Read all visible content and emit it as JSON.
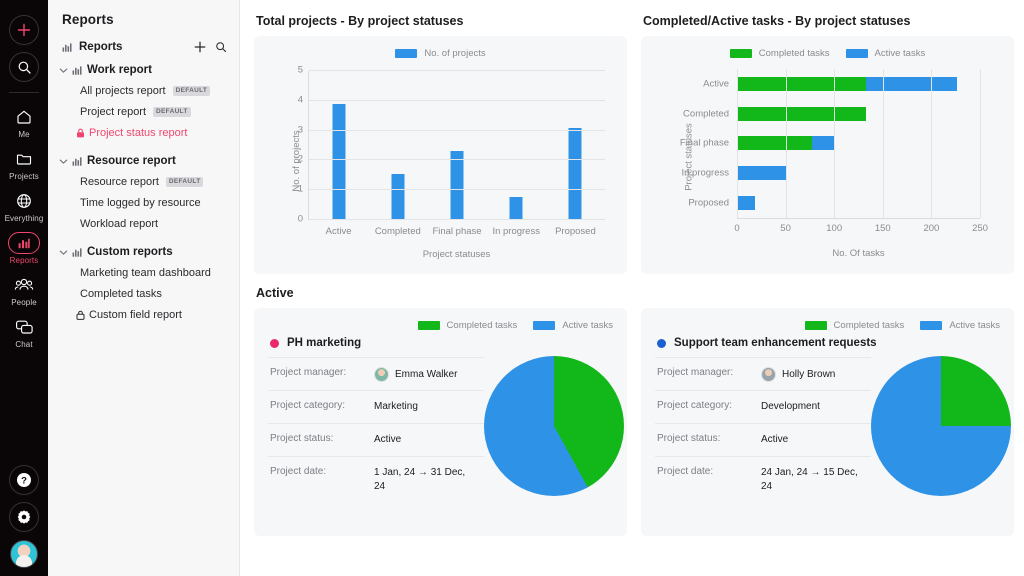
{
  "colors": {
    "green": "#12b81a",
    "blue": "#2e93e6",
    "accent_pink": "#f0466e",
    "pink_dot": "#e8286b",
    "blue_dot": "#1c5fd0",
    "rail_bg": "#0a0608",
    "panel_bg": "#f7f7f8",
    "card_bg": "#f6f7f9"
  },
  "rail": {
    "add_icon": "plus-icon",
    "search_icon": "search-icon",
    "items": [
      {
        "label": "Me",
        "icon": "home-icon",
        "active": false
      },
      {
        "label": "Projects",
        "icon": "folder-icon",
        "active": false
      },
      {
        "label": "Everything",
        "icon": "globe-icon",
        "active": false
      },
      {
        "label": "Reports",
        "icon": "bar-chart-icon",
        "active": true
      },
      {
        "label": "People",
        "icon": "people-icon",
        "active": false
      },
      {
        "label": "Chat",
        "icon": "chat-icon",
        "active": false
      }
    ],
    "bottom": [
      {
        "icon": "help-icon"
      },
      {
        "icon": "settings-gear-icon"
      },
      {
        "icon": "user-avatar"
      }
    ]
  },
  "panel": {
    "title": "Reports",
    "root": {
      "label": "Reports",
      "icon": "bar-chart-icon"
    },
    "actions": {
      "add": "plus-icon",
      "search": "search-icon"
    },
    "badge_default": "DEFAULT",
    "groups": [
      {
        "label": "Work report",
        "expanded": true,
        "items": [
          {
            "label": "All projects report",
            "badge": "DEFAULT",
            "locked": false,
            "selected": false
          },
          {
            "label": "Project report",
            "badge": "DEFAULT",
            "locked": false,
            "selected": false
          },
          {
            "label": "Project status report",
            "badge": "",
            "locked": true,
            "selected": true
          }
        ]
      },
      {
        "label": "Resource report",
        "expanded": true,
        "items": [
          {
            "label": "Resource report",
            "badge": "DEFAULT",
            "locked": false,
            "selected": false
          },
          {
            "label": "Time logged by resource",
            "badge": "",
            "locked": false,
            "selected": false
          },
          {
            "label": "Workload report",
            "badge": "",
            "locked": false,
            "selected": false
          }
        ]
      },
      {
        "label": "Custom reports",
        "expanded": true,
        "items": [
          {
            "label": "Marketing team dashboard",
            "badge": "",
            "locked": false,
            "selected": false
          },
          {
            "label": "Completed tasks",
            "badge": "",
            "locked": false,
            "selected": false
          },
          {
            "label": "Custom field report",
            "badge": "",
            "locked": true,
            "selected": false
          }
        ]
      }
    ]
  },
  "main": {
    "section_titles": {
      "total_projects": "Total projects - By project statuses",
      "completed_active": "Completed/Active tasks - By project statuses",
      "active": "Active"
    }
  },
  "chart_data": [
    {
      "type": "bar",
      "title": "Total projects - By project statuses",
      "legend": [
        "No. of projects"
      ],
      "legend_position": "top-center",
      "categories": [
        "Active",
        "Completed",
        "Final phase",
        "In progress",
        "Proposed"
      ],
      "values": [
        3.9,
        1.55,
        2.3,
        0.77,
        3.1
      ],
      "xlabel": "Project statuses",
      "ylabel": "No. of projects",
      "ylim": [
        0,
        5
      ],
      "yticks": [
        0,
        1,
        2,
        3,
        4,
        5
      ],
      "grid": true,
      "color": "#2e93e6"
    },
    {
      "type": "bar",
      "orientation": "horizontal",
      "stacked": true,
      "title": "Completed/Active tasks - By project statuses",
      "legend": [
        "Completed tasks",
        "Active tasks"
      ],
      "legend_position": "top-center",
      "categories": [
        "Active",
        "Completed",
        "Final phase",
        "In progress",
        "Proposed"
      ],
      "series": [
        {
          "name": "Completed tasks",
          "values": [
            133,
            133,
            77,
            0,
            0
          ],
          "color": "#12b81a"
        },
        {
          "name": "Active tasks",
          "values": [
            93,
            0,
            24,
            51,
            19
          ],
          "color": "#2e93e6"
        }
      ],
      "xlabel": "No. Of tasks",
      "ylabel": "Project statuses",
      "xlim": [
        0,
        250
      ],
      "xticks": [
        0,
        50,
        100,
        150,
        200,
        250
      ],
      "grid": true
    },
    {
      "type": "pie",
      "title": "PH marketing",
      "legend": [
        "Completed tasks",
        "Active tasks"
      ],
      "labels": [
        "Completed tasks",
        "Active tasks"
      ],
      "values": [
        42,
        58
      ],
      "colors": [
        "#12b81a",
        "#2e93e6"
      ]
    },
    {
      "type": "pie",
      "title": "Support team enhancement requests",
      "legend": [
        "Completed tasks",
        "Active tasks"
      ],
      "labels": [
        "Completed tasks",
        "Active tasks"
      ],
      "values": [
        25,
        75
      ],
      "colors": [
        "#12b81a",
        "#2e93e6"
      ]
    }
  ],
  "project_cards": [
    {
      "name": "PH marketing",
      "dot_color": "#e8286b",
      "legend": [
        {
          "label": "Completed tasks",
          "color": "#12b81a"
        },
        {
          "label": "Active tasks",
          "color": "#2e93e6"
        }
      ],
      "rows": [
        {
          "key": "Project manager:",
          "value": "Emma Walker",
          "avatar": true
        },
        {
          "key": "Project category:",
          "value": "Marketing",
          "avatar": false
        },
        {
          "key": "Project status:",
          "value": "Active",
          "avatar": false
        },
        {
          "key": "Project date:",
          "value": "1 Jan, 24 → 31 Dec, 24",
          "avatar": false
        }
      ]
    },
    {
      "name": "Support team enhancement requests",
      "dot_color": "#1c5fd0",
      "legend": [
        {
          "label": "Completed tasks",
          "color": "#12b81a"
        },
        {
          "label": "Active tasks",
          "color": "#2e93e6"
        }
      ],
      "rows": [
        {
          "key": "Project manager:",
          "value": "Holly Brown",
          "avatar": true
        },
        {
          "key": "Project category:",
          "value": "Development",
          "avatar": false
        },
        {
          "key": "Project status:",
          "value": "Active",
          "avatar": false
        },
        {
          "key": "Project date:",
          "value": "24 Jan, 24 → 15 Dec, 24",
          "avatar": false
        }
      ]
    }
  ]
}
